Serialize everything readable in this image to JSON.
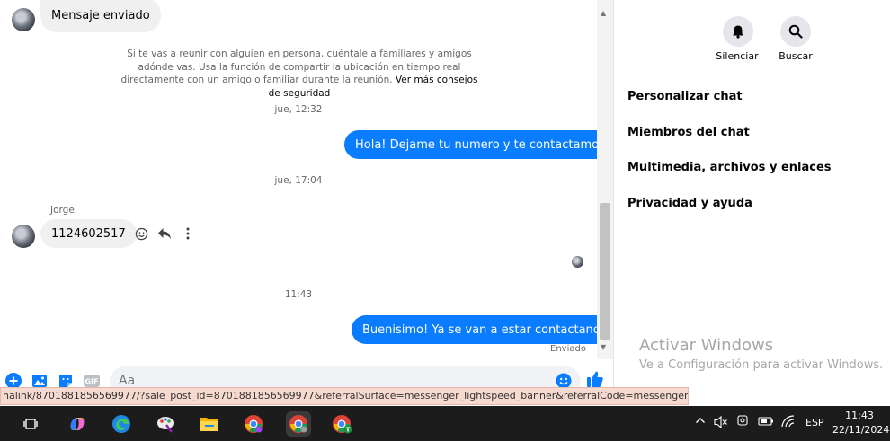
{
  "chat": {
    "top_message": "Mensaje enviado",
    "notice_text": "Si te vas a reunir con alguien en persona, cuéntale a familiares y amigos adónde vas. Usa la función de compartir la ubicación en tiempo real directamente con un amigo o familiar durante la reunión.",
    "notice_link": "Ver más consejos de seguridad",
    "timestamps": [
      "jue, 12:32",
      "jue, 17:04",
      "11:43"
    ],
    "outgoing_1": "Hola! Dejame tu numero y te contactamos",
    "sender_name": "Jorge",
    "incoming_1": "1124602517",
    "outgoing_2": "Buenisimo! Ya se van a estar contactando",
    "sent_status": "Enviado"
  },
  "composer": {
    "placeholder": "Aa"
  },
  "side": {
    "mute_label": "Silenciar",
    "search_label": "Buscar",
    "items": [
      "Personalizar chat",
      "Miembros del chat",
      "Multimedia, archivos y enlaces",
      "Privacidad y ayuda"
    ],
    "activate_title": "Activar Windows",
    "activate_sub": "Ve a Configuración para activar Windows."
  },
  "status_url": "nalink/8701881856569977/?sale_post_id=8701881856569977&referralSurface=messenger_lightspeed_banner&referralCode=messenger_banner",
  "taskbar": {
    "lang": "ESP",
    "time": "11:43",
    "date": "22/11/2024",
    "chrome_badge": "T"
  },
  "colors": {
    "messenger_blue": "#0a7cff",
    "incoming_bubble": "#f0f0f0",
    "taskbar_bg": "#1c1c1c"
  }
}
